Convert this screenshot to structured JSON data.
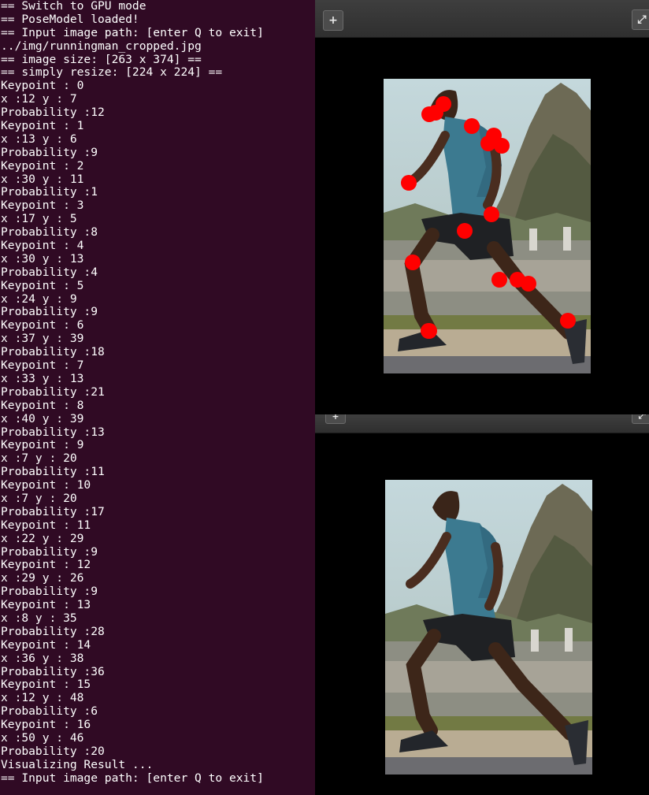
{
  "terminal": {
    "lines": [
      "== Switch to GPU mode",
      "== PoseModel loaded!",
      "== Input image path: [enter Q to exit]",
      "../img/runningman_cropped.jpg",
      "== image size: [263 x 374] ==",
      "== simply resize: [224 x 224] ==",
      "Keypoint : 0",
      "x :12 y : 7",
      "Probability :12",
      "Keypoint : 1",
      "x :13 y : 6",
      "Probability :9",
      "Keypoint : 2",
      "x :30 y : 11",
      "Probability :1",
      "Keypoint : 3",
      "x :17 y : 5",
      "Probability :8",
      "Keypoint : 4",
      "x :30 y : 13",
      "Probability :4",
      "Keypoint : 5",
      "x :24 y : 9",
      "Probability :9",
      "Keypoint : 6",
      "x :37 y : 39",
      "Probability :18",
      "Keypoint : 7",
      "x :33 y : 13",
      "Probability :21",
      "Keypoint : 8",
      "x :40 y : 39",
      "Probability :13",
      "Keypoint : 9",
      "x :7 y : 20",
      "Probability :11",
      "Keypoint : 10",
      "x :7 y : 20",
      "Probability :17",
      "Keypoint : 11",
      "x :22 y : 29",
      "Probability :9",
      "Keypoint : 12",
      "x :29 y : 26",
      "Probability :9",
      "Keypoint : 13",
      "x :8 y : 35",
      "Probability :28",
      "Keypoint : 14",
      "x :36 y : 38",
      "Probability :36",
      "Keypoint : 15",
      "x :12 y : 48",
      "Probability :6",
      "Keypoint : 16",
      "x :50 y : 46",
      "Probability :20",
      "Visualizing Result ...",
      "== Input image path: [enter Q to exit]"
    ]
  },
  "viewers": {
    "add_icon": "plus-icon",
    "add_glyph": "+",
    "fullscreen_icon": "fullscreen-icon",
    "fullscreen_glyph": "⤢"
  },
  "keypoint_overlay": {
    "color": "#ff0000",
    "marker_count": 17
  },
  "colors": {
    "terminal_bg": "#300a24",
    "terminal_fg": "#ffffff",
    "viewer_bg": "#000000"
  }
}
